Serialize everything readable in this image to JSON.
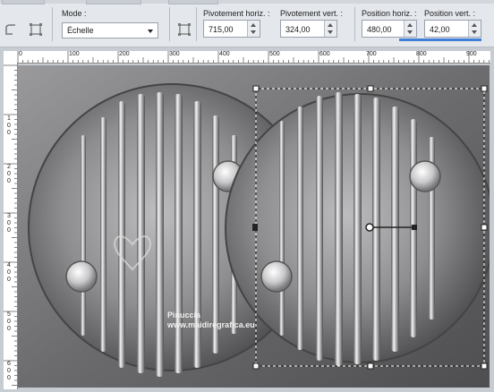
{
  "toolbar": {
    "mode_label": "Mode :",
    "mode_value": "Échelle",
    "pivot_h_label": "Pivotement horiz. :",
    "pivot_h_value": "715,00",
    "pivot_v_label": "Pivotement vert. :",
    "pivot_v_value": "324,00",
    "pos_h_label": "Position horiz. :",
    "pos_h_value": "480,00",
    "pos_v_label": "Position vert. :",
    "pos_v_value": "42,00"
  },
  "ruler": {
    "top_labels": [
      "0",
      "100",
      "200",
      "300",
      "400",
      "500",
      "600",
      "700",
      "800",
      "900"
    ],
    "left_labels": [
      "1\n0\n0",
      "2\n0\n0",
      "3\n0\n0",
      "4\n0\n0",
      "5\n0\n0",
      "6\n0\n0"
    ]
  },
  "watermark": {
    "line1": "Pinuccia",
    "line2": "www.maidiregrafica.eu"
  },
  "colors": {
    "toolbar_bg": "#e4e7ec",
    "selection_marquee": "#ffffff",
    "accent": "#3f7fd8"
  }
}
